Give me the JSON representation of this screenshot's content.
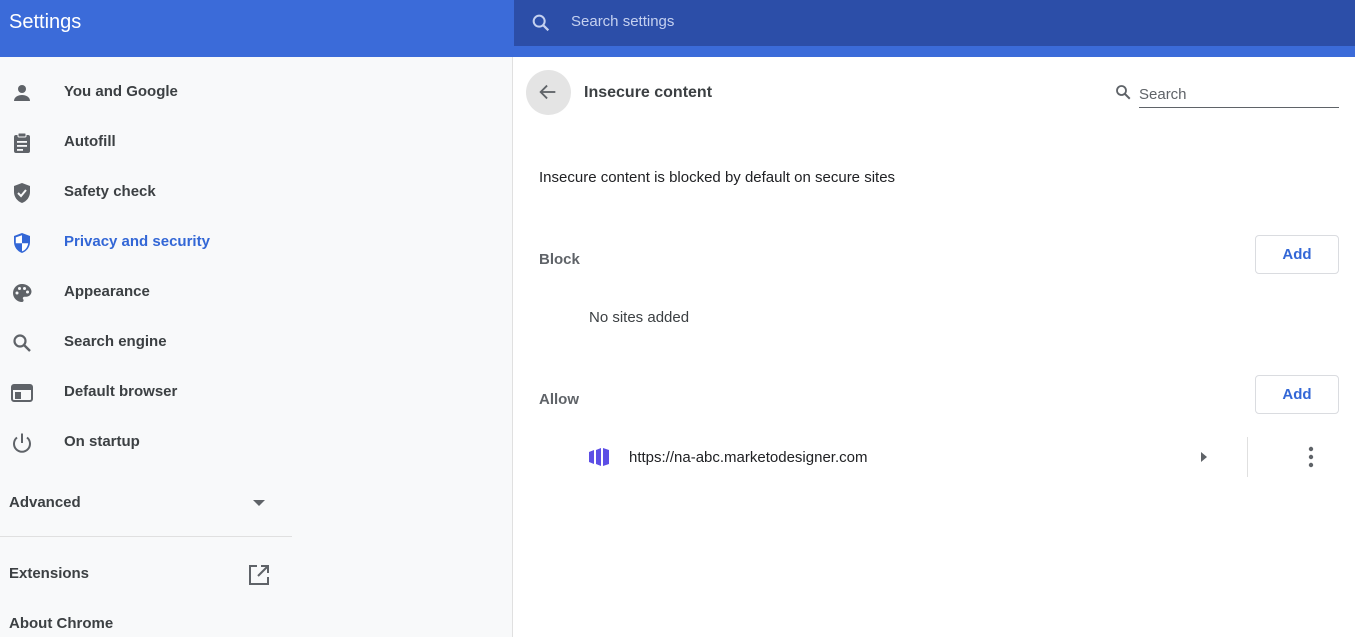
{
  "header": {
    "title": "Settings",
    "search_placeholder": "Search settings",
    "bg_color": "#3b6bd9",
    "search_bg_color": "#2c4ea8"
  },
  "sidebar": {
    "items": [
      {
        "label": "You and Google",
        "icon": "person-icon",
        "active": false
      },
      {
        "label": "Autofill",
        "icon": "clipboard-icon",
        "active": false
      },
      {
        "label": "Safety check",
        "icon": "shield-check-icon",
        "active": false
      },
      {
        "label": "Privacy and security",
        "icon": "shield-icon",
        "active": true
      },
      {
        "label": "Appearance",
        "icon": "palette-icon",
        "active": false
      },
      {
        "label": "Search engine",
        "icon": "search-icon",
        "active": false
      },
      {
        "label": "Default browser",
        "icon": "browser-icon",
        "active": false
      },
      {
        "label": "On startup",
        "icon": "power-icon",
        "active": false
      }
    ],
    "advanced_label": "Advanced",
    "extensions_label": "Extensions",
    "about_label": "About Chrome",
    "active_color": "#3367d6"
  },
  "main": {
    "title": "Insecure content",
    "search_placeholder": "Search",
    "description": "Insecure content is blocked by default on secure sites",
    "block": {
      "label": "Block",
      "add_label": "Add",
      "empty_text": "No sites added"
    },
    "allow": {
      "label": "Allow",
      "add_label": "Add",
      "sites": [
        {
          "url": "https://na-abc.marketodesigner.com",
          "favicon": "marketo-icon"
        }
      ]
    }
  }
}
